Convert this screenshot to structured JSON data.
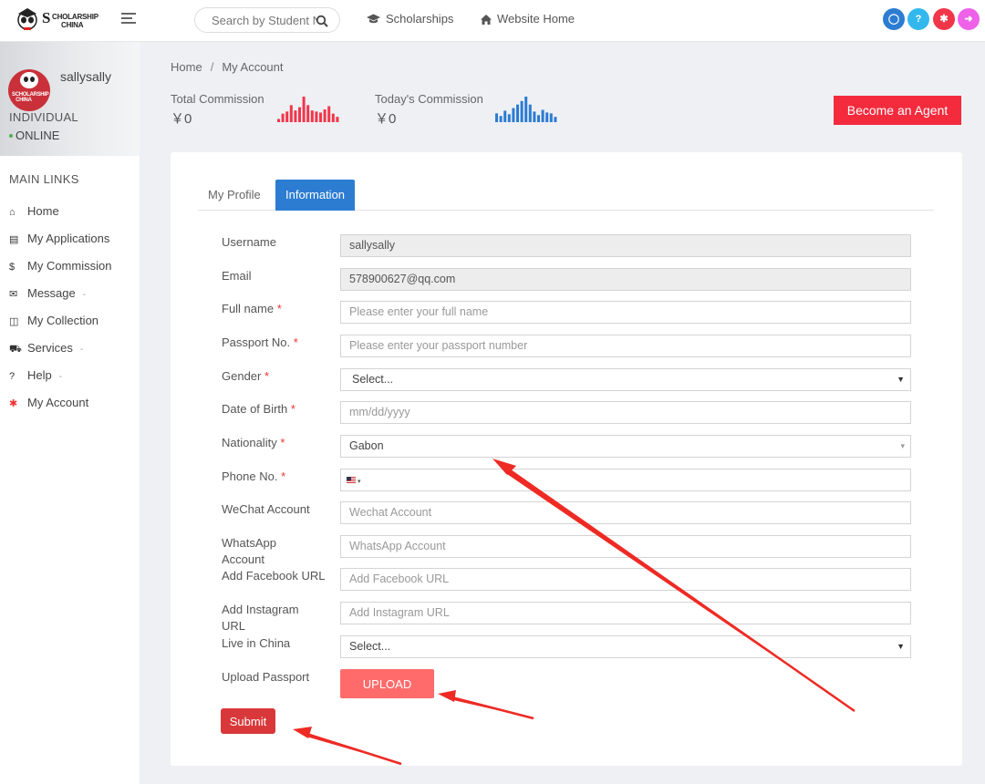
{
  "header": {
    "logo_s": "S",
    "logo_line1": "CHOLARSHIP",
    "logo_line2": "CHINA",
    "search_placeholder": "Search by Student Name",
    "nav": [
      {
        "label": "Scholarships",
        "icon": "graduation-cap-icon"
      },
      {
        "label": "Website Home",
        "icon": "home-icon"
      }
    ],
    "action_buttons": [
      {
        "name": "chat-icon",
        "glyph": "◯",
        "color": "#2c7cd2"
      },
      {
        "name": "help-icon",
        "glyph": "?",
        "color": "#33b8ee"
      },
      {
        "name": "gear-icon",
        "glyph": "✱",
        "color": "#f2364a"
      },
      {
        "name": "logout-icon",
        "glyph": "➜",
        "color": "#ee61e8"
      }
    ]
  },
  "sidebar": {
    "username": "sallysally",
    "user_type": "INDIVIDUAL",
    "status": "ONLINE",
    "section_title": "MAIN LINKS",
    "items": [
      {
        "label": "Home",
        "icon": "home-icon",
        "glyph": "⌂",
        "caret": false
      },
      {
        "label": "My Applications",
        "icon": "file-icon",
        "glyph": "▤",
        "caret": false
      },
      {
        "label": "My Commission",
        "icon": "dollar-icon",
        "glyph": "$",
        "caret": false
      },
      {
        "label": "Message",
        "icon": "envelope-icon",
        "glyph": "✉",
        "caret": true
      },
      {
        "label": "My Collection",
        "icon": "inbox-icon",
        "glyph": "◫",
        "caret": false
      },
      {
        "label": "Services",
        "icon": "car-icon",
        "glyph": "⛟",
        "caret": true
      },
      {
        "label": "Help",
        "icon": "question-icon",
        "glyph": "?",
        "caret": true
      },
      {
        "label": "My Account",
        "icon": "gear-icon",
        "glyph": "✱",
        "caret": false
      }
    ]
  },
  "breadcrumb": {
    "home": "Home",
    "separator": "/",
    "current": "My Account"
  },
  "stats": {
    "total": {
      "label": "Total Commission",
      "value": "￥0",
      "color": "#f2364a",
      "bars": [
        3,
        8,
        10,
        16,
        11,
        14,
        24,
        16,
        11,
        10,
        9,
        12,
        15,
        8,
        5
      ]
    },
    "today": {
      "label": "Today's Commission",
      "value": "￥0",
      "color": "#2c7cd2",
      "bars": [
        10,
        7,
        13,
        9,
        16,
        20,
        24,
        29,
        20,
        12,
        8,
        14,
        11,
        10,
        6
      ]
    }
  },
  "agent_button": "Become an Agent",
  "tabs": {
    "profile": "My Profile",
    "information": "Information"
  },
  "form": {
    "required_mark": "*",
    "username": {
      "label": "Username",
      "value": "sallysally"
    },
    "email": {
      "label": "Email",
      "value": "578900627@qq.com"
    },
    "full_name": {
      "label": "Full name",
      "placeholder": "Please enter your full name"
    },
    "passport_no": {
      "label": "Passport No.",
      "placeholder": "Please enter your passport number"
    },
    "gender": {
      "label": "Gender",
      "value": "Select..."
    },
    "dob": {
      "label": "Date of Birth",
      "placeholder": "mm/dd/yyyy"
    },
    "nationality": {
      "label": "Nationality",
      "value": "Gabon"
    },
    "phone": {
      "label": "Phone No.",
      "value": ""
    },
    "wechat": {
      "label": "WeChat Account",
      "placeholder": "Wechat Account"
    },
    "whatsapp": {
      "label_line1": "WhatsApp",
      "label_line2": "Account",
      "placeholder": "WhatsApp Account"
    },
    "facebook": {
      "label": "Add Facebook URL",
      "placeholder": "Add Facebook URL"
    },
    "instagram": {
      "label_line1": "Add Instagram",
      "label_line2": "URL",
      "placeholder": "Add Instagram URL"
    },
    "live_in_china": {
      "label": "Live in China",
      "value": "Select..."
    },
    "upload_passport": {
      "label": "Upload Passport",
      "button": "UPLOAD"
    },
    "submit": "Submit"
  },
  "annotation_color": "#ee2a24"
}
